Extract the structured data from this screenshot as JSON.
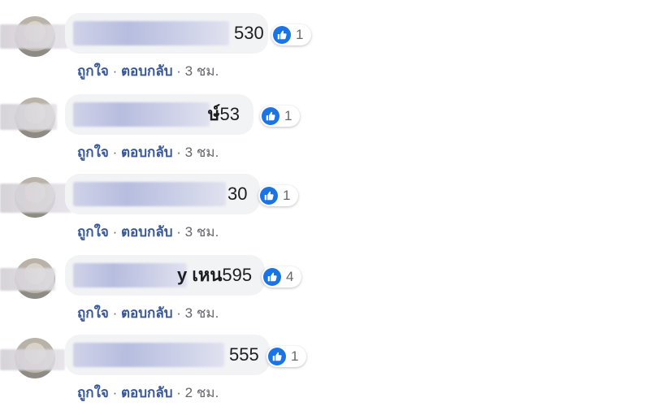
{
  "actions": {
    "like_label": "ถูกใจ",
    "reply_label": "ตอบกลับ",
    "separator": "·"
  },
  "comments": [
    {
      "name_visible": "",
      "text": "530",
      "reaction_count": "1",
      "time": "3 ชม."
    },
    {
      "name_visible": "ษ์",
      "text": "53",
      "reaction_count": "1",
      "time": "3 ชม."
    },
    {
      "name_visible": "",
      "text": "30",
      "reaction_count": "1",
      "time": "3 ชม."
    },
    {
      "name_visible": "y เหน",
      "text": "595",
      "reaction_count": "4",
      "time": "3 ชม."
    },
    {
      "name_visible": "",
      "text": "555",
      "reaction_count": "1",
      "time": "2 ชม."
    }
  ],
  "colors": {
    "like_blue": "#1b74e4",
    "link": "#385898",
    "meta": "#65676b",
    "bubble": "#f2f3f5"
  },
  "icons": {
    "reaction": "thumbs-up-icon"
  }
}
